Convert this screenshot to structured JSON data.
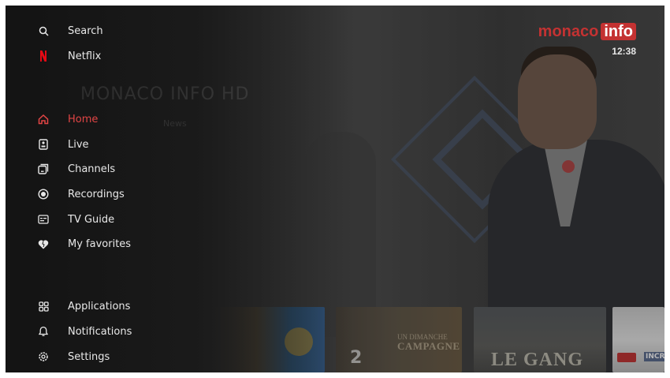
{
  "header": {
    "logo_part1": "monaco",
    "logo_part2": "info",
    "clock": "12:38"
  },
  "background": {
    "channel_title": "MONACO INFO HD",
    "meta": "News",
    "thumbnails": [
      {
        "label": "",
        "number": ""
      },
      {
        "title_small": "UN DIMANCHE",
        "title_large": "CAMPAGNE",
        "number": "2"
      },
      {
        "title": "LE GANG"
      },
      {
        "title": "INCRO"
      }
    ]
  },
  "menu": {
    "top": [
      {
        "label": "Search",
        "icon": "search-icon"
      },
      {
        "label": "Netflix",
        "icon": "netflix-icon"
      }
    ],
    "main": [
      {
        "label": "Home",
        "icon": "home-icon",
        "active": true
      },
      {
        "label": "Live",
        "icon": "live-icon"
      },
      {
        "label": "Channels",
        "icon": "channels-icon"
      },
      {
        "label": "Recordings",
        "icon": "recordings-icon"
      },
      {
        "label": "TV Guide",
        "icon": "tv-guide-icon"
      },
      {
        "label": "My favorites",
        "icon": "favorites-icon"
      }
    ],
    "bottom": [
      {
        "label": "Applications",
        "icon": "applications-icon"
      },
      {
        "label": "Notifications",
        "icon": "notifications-icon"
      },
      {
        "label": "Settings",
        "icon": "settings-icon"
      }
    ]
  },
  "colors": {
    "accent": "#e24545",
    "brand_red": "#c43232",
    "menu_text": "#e8e8e8"
  }
}
